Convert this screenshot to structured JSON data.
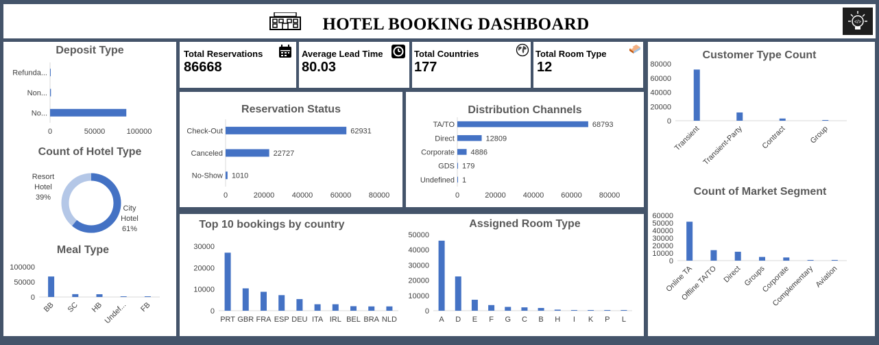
{
  "header": {
    "title": "HOTEL BOOKING DASHBOARD",
    "logo_icon": "hotel-building-icon",
    "corner_icon": "lightbulb-icon"
  },
  "colors": {
    "background": "#44546a",
    "bar": "#4472c4",
    "donut_light": "#b4c7e7"
  },
  "kpis": [
    {
      "label": "Total Reservations",
      "value": "86668",
      "icon": "calendar-icon"
    },
    {
      "label": "Average Lead Time",
      "value": "80.03",
      "icon": "clock-icon"
    },
    {
      "label": "Total Countries",
      "value": "177",
      "icon": "globe-icon"
    },
    {
      "label": "Total Room Type",
      "value": "12",
      "icon": "bed-icon"
    }
  ],
  "chart_data": [
    {
      "id": "deposit",
      "type": "bar",
      "orientation": "horizontal",
      "title": "Deposit Type",
      "categories": [
        "Refunda...",
        "Non...",
        "No..."
      ],
      "values": [
        100,
        1000,
        85568
      ],
      "xlim": [
        0,
        100000
      ],
      "ticks": [
        "0",
        "50000",
        "100000"
      ]
    },
    {
      "id": "hoteltype",
      "type": "pie",
      "title": "Count of Hotel Type",
      "slices": [
        {
          "name": "Resort Hotel",
          "value": 39,
          "label": "39%"
        },
        {
          "name": "City Hotel",
          "value": 61,
          "label": "61%"
        }
      ]
    },
    {
      "id": "meal",
      "type": "bar",
      "title": "Meal Type",
      "categories": [
        "BB",
        "SC",
        "HB",
        "Undef...",
        "FB"
      ],
      "values": [
        67900,
        9400,
        9100,
        500,
        360
      ],
      "ylim": [
        0,
        100000
      ],
      "ticks": [
        "0",
        "50000",
        "100000"
      ]
    },
    {
      "id": "status",
      "type": "bar",
      "orientation": "horizontal",
      "title": "Reservation Status",
      "categories": [
        "Check-Out",
        "Canceled",
        "No-Show"
      ],
      "values": [
        62931,
        22727,
        1010
      ],
      "xlim": [
        0,
        80000
      ],
      "ticks": [
        "0",
        "20000",
        "40000",
        "60000",
        "80000"
      ]
    },
    {
      "id": "channels",
      "type": "bar",
      "orientation": "horizontal",
      "title": "Distribution Channels",
      "categories": [
        "TA/TO",
        "Direct",
        "Corporate",
        "GDS",
        "Undefined"
      ],
      "values": [
        68793,
        12809,
        4886,
        179,
        1
      ],
      "xlim": [
        0,
        80000
      ],
      "ticks": [
        "0",
        "20000",
        "40000",
        "60000",
        "80000"
      ]
    },
    {
      "id": "country",
      "type": "bar",
      "title": "Top 10 bookings by country",
      "categories": [
        "PRT",
        "GBR",
        "FRA",
        "ESP",
        "DEU",
        "ITA",
        "IRL",
        "BEL",
        "BRA",
        "NLD"
      ],
      "values": [
        27000,
        10400,
        8800,
        7250,
        5400,
        3000,
        3000,
        2100,
        2000,
        2000
      ],
      "ylim": [
        0,
        30000
      ],
      "ticks": [
        "0",
        "10000",
        "20000",
        "30000"
      ]
    },
    {
      "id": "room",
      "type": "bar",
      "title": "Assigned Room Type",
      "categories": [
        "A",
        "D",
        "E",
        "F",
        "G",
        "C",
        "B",
        "H",
        "I",
        "K",
        "P",
        "L"
      ],
      "values": [
        46000,
        22500,
        7200,
        3700,
        2500,
        2200,
        1800,
        700,
        350,
        280,
        10,
        1
      ],
      "ylim": [
        0,
        50000
      ],
      "ticks": [
        "0",
        "10000",
        "20000",
        "30000",
        "40000",
        "50000"
      ]
    },
    {
      "id": "customer",
      "type": "bar",
      "title": "Customer Type Count",
      "categories": [
        "Transient",
        "Transient-Party",
        "Contract",
        "Group"
      ],
      "values": [
        71900,
        11600,
        3100,
        550
      ],
      "ylim": [
        0,
        80000
      ],
      "ticks": [
        "0",
        "20000",
        "40000",
        "60000",
        "80000"
      ]
    },
    {
      "id": "market",
      "type": "bar",
      "title": "Count of Market Segment",
      "categories": [
        "Online TA",
        "Offline TA/TO",
        "Direct",
        "Groups",
        "Corporate",
        "Complementary",
        "Aviation"
      ],
      "values": [
        51600,
        13900,
        11800,
        4900,
        4200,
        700,
        230
      ],
      "ylim": [
        0,
        60000
      ],
      "ticks": [
        "0",
        "10000",
        "20000",
        "30000",
        "40000",
        "50000",
        "60000"
      ]
    }
  ]
}
